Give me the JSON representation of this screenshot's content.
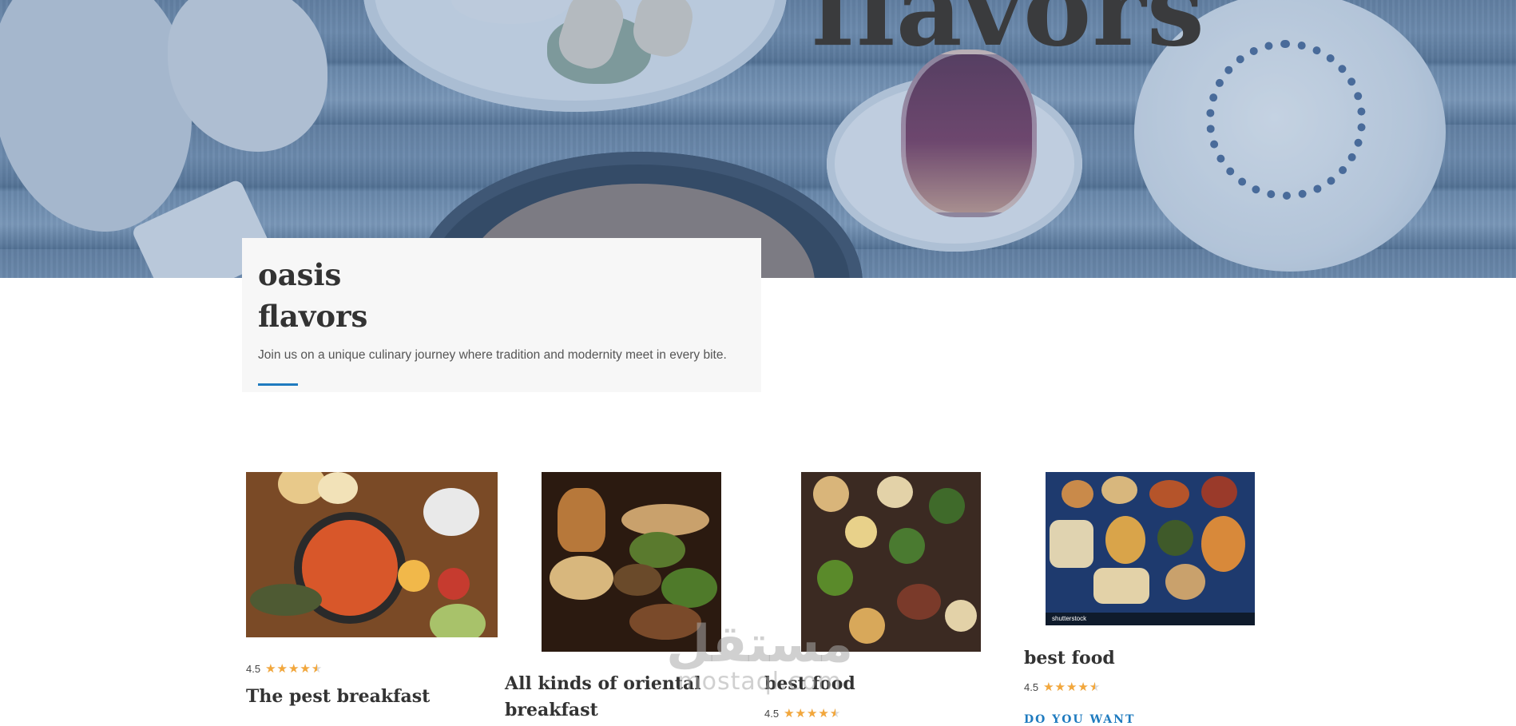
{
  "hero": {
    "title": "flavors"
  },
  "intro": {
    "title_line1": "oasis",
    "title_line2": "flavors",
    "text": "Join us on a unique culinary journey where tradition and modernity meet in every bite."
  },
  "cards": [
    {
      "rating": "4.5",
      "stars": 4.5,
      "title": "The pest breakfast"
    },
    {
      "title_line1": "All kinds of oriental",
      "title_line2": "breakfast"
    },
    {
      "title": "best food",
      "rating": "4.5",
      "stars": 4.5
    },
    {
      "title": "best food",
      "rating": "4.5",
      "stars": 4.5,
      "cta": "DO YOU WANT",
      "image_credit": "shutterstock"
    }
  ],
  "watermark": {
    "arabic": "مستقل",
    "latin": "mostaql.com"
  },
  "colors": {
    "accent": "#1f7bbf",
    "star": "#f3a73b",
    "card_bg": "#f7f7f7"
  },
  "icons": {
    "star": "star-icon"
  }
}
